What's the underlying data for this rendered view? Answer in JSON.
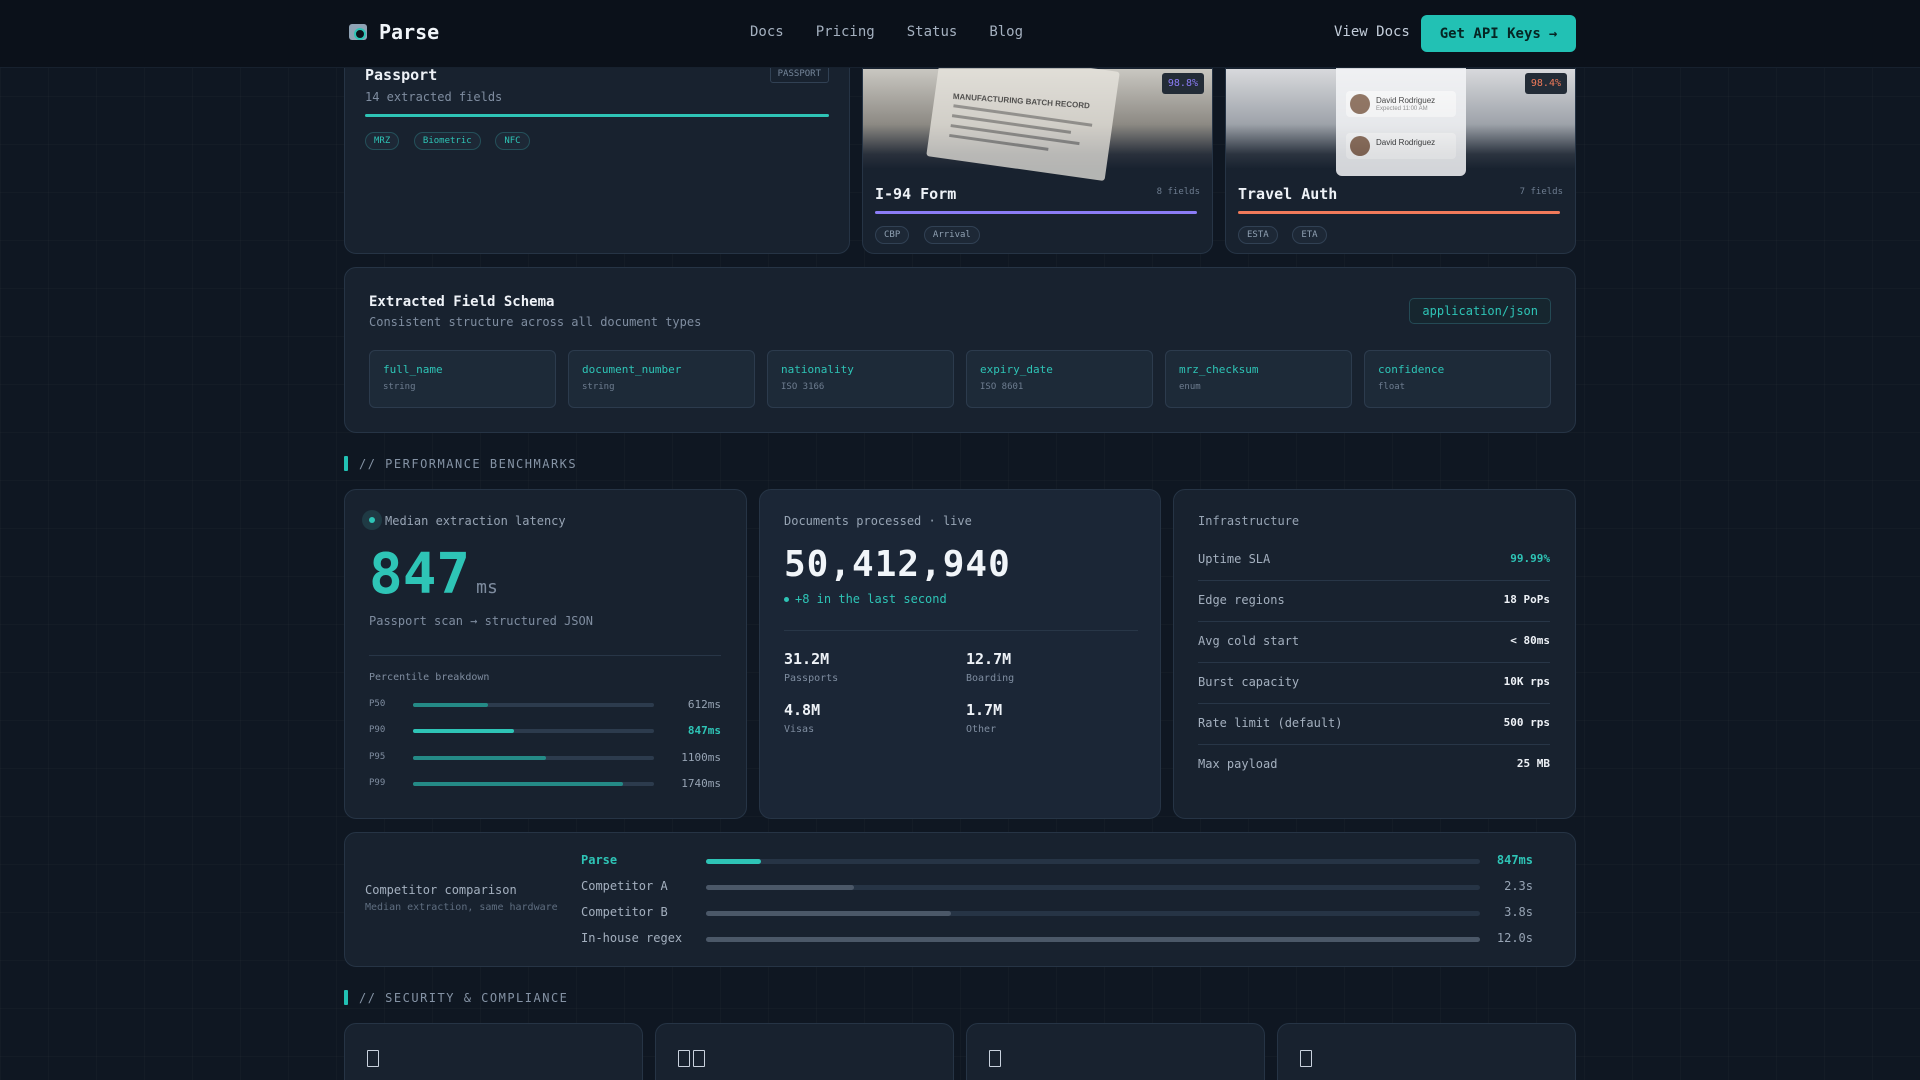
{
  "nav": {
    "brand": "Parse",
    "links": [
      "Docs",
      "Pricing",
      "Status",
      "Blog"
    ],
    "view_docs": "View Docs",
    "cta": "Get API Keys",
    "cta_arrow": "→"
  },
  "doc_cards": {
    "passport": {
      "title": "Passport",
      "subtitle": "14 extracted fields",
      "tag": "PASSPORT",
      "chips": [
        "MRZ",
        "Biometric",
        "NFC"
      ],
      "accent": "#2ec4b6"
    },
    "i94": {
      "title": "I-94 Form",
      "fields": "8 fields",
      "confidence": "98.8%",
      "chips": [
        "CBP",
        "Arrival"
      ],
      "accent": "#8b7cf6",
      "photo_heading": "MANUFACTURING BATCH RECORD"
    },
    "travel": {
      "title": "Travel Auth",
      "fields": "7 fields",
      "confidence": "98.4%",
      "chips": [
        "ESTA",
        "ETA"
      ],
      "accent": "#f07a5a",
      "photo_names": [
        "David Rodriguez",
        "David Rodriguez"
      ],
      "photo_expires": "Expected 11:00 AM"
    }
  },
  "schema": {
    "title": "Extracted Field Schema",
    "subtitle": "Consistent structure across all document types",
    "format": "application/json",
    "fields": [
      {
        "name": "full_name",
        "type": "string"
      },
      {
        "name": "document_number",
        "type": "string"
      },
      {
        "name": "nationality",
        "type": "ISO 3166"
      },
      {
        "name": "expiry_date",
        "type": "ISO 8601"
      },
      {
        "name": "mrz_checksum",
        "type": "enum"
      },
      {
        "name": "confidence",
        "type": "float"
      }
    ]
  },
  "perf_section": "// PERFORMANCE BENCHMARKS",
  "latency": {
    "label": "Median extraction latency",
    "value": "847",
    "unit": "ms",
    "caption": "Passport scan → structured JSON",
    "breakdown_label": "Percentile breakdown",
    "percentiles": [
      {
        "key": "P50",
        "value": "612ms",
        "fraction": 0.31,
        "highlight": false
      },
      {
        "key": "P90",
        "value": "847ms",
        "fraction": 0.42,
        "highlight": true
      },
      {
        "key": "P95",
        "value": "1100ms",
        "fraction": 0.55,
        "highlight": false
      },
      {
        "key": "P99",
        "value": "1740ms",
        "fraction": 0.87,
        "highlight": false
      }
    ]
  },
  "docs_processed": {
    "label": "Documents processed · live",
    "value": "50,412,940",
    "live_note": "+8 in the last second",
    "stats": [
      {
        "value": "31.2M",
        "label": "Passports"
      },
      {
        "value": "12.7M",
        "label": "Boarding"
      },
      {
        "value": "4.8M",
        "label": "Visas"
      },
      {
        "value": "1.7M",
        "label": "Other"
      }
    ]
  },
  "infra": {
    "label": "Infrastructure",
    "rows": [
      {
        "key": "Uptime SLA",
        "value": "99.99%",
        "accent": true
      },
      {
        "key": "Edge regions",
        "value": "18 PoPs",
        "accent": false
      },
      {
        "key": "Avg cold start",
        "value": "< 80ms",
        "accent": false
      },
      {
        "key": "Burst capacity",
        "value": "10K rps",
        "accent": false
      },
      {
        "key": "Rate limit (default)",
        "value": "500 rps",
        "accent": false
      },
      {
        "key": "Max payload",
        "value": "25 MB",
        "accent": false
      }
    ]
  },
  "competitor": {
    "title": "Competitor comparison",
    "subtitle": "Median extraction, same hardware",
    "rows": [
      {
        "name": "Parse",
        "value": "847ms",
        "fraction": 0.0706,
        "highlight": true
      },
      {
        "name": "Competitor A",
        "value": "2.3s",
        "fraction": 0.1917,
        "highlight": false
      },
      {
        "name": "Competitor B",
        "value": "3.8s",
        "fraction": 0.3167,
        "highlight": false
      },
      {
        "name": "In-house regex",
        "value": "12.0s",
        "fraction": 1.0,
        "highlight": false
      }
    ]
  },
  "security_section": "// SECURITY & COMPLIANCE",
  "security_cards": [
    {
      "icon": "lock-icon",
      "glyph_count": 1
    },
    {
      "icon": "shield-check-icon",
      "glyph_count": 2
    },
    {
      "icon": "document-icon",
      "glyph_count": 1
    },
    {
      "icon": "key-icon",
      "glyph_count": 1
    }
  ],
  "colors": {
    "accent": "#2ec4b6",
    "background": "#0f1722",
    "card": "#18222f"
  }
}
